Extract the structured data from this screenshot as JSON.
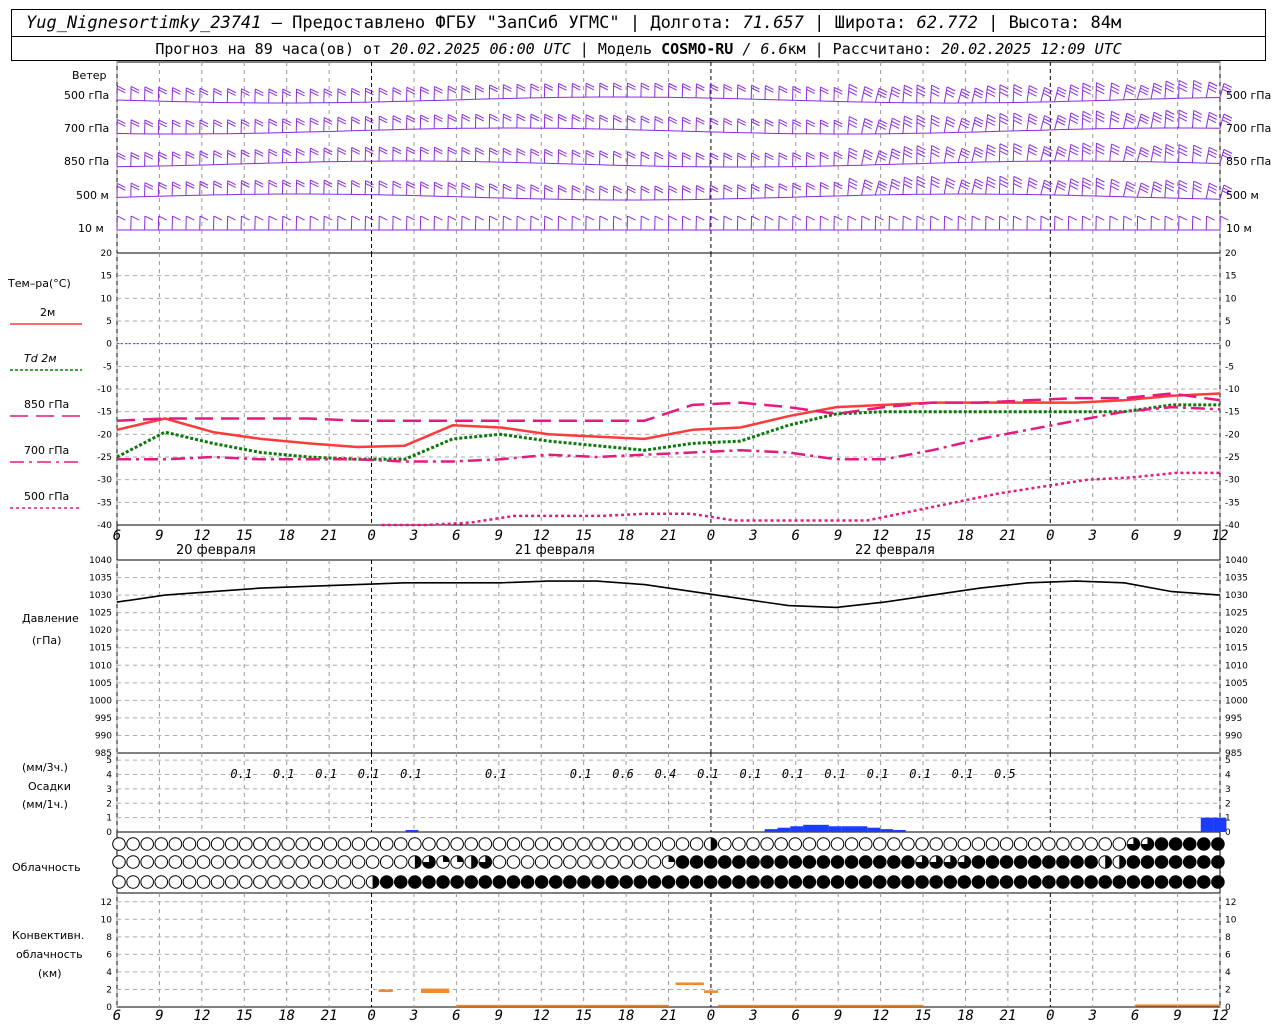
{
  "header": {
    "station": "Yug_Nignesortimky_23741",
    "provider": " – Предоставлено ФГБУ \"ЗапСиб УГМС\" | Долгота: ",
    "lon": "71.657",
    "lat_label": " | Широта: ",
    "lat": "62.772",
    "alt_label": " | Высота: ",
    "alt": "84м",
    "forecast_label": "Прогноз на 89 часа(ов) от ",
    "forecast_time": "20.02.2025 06:00 UTC",
    "model_label": "  | Модель ",
    "model": "COSMO-RU",
    "res": " / 6.6",
    "res_unit": "км",
    "calc_label": " | Рассчитано: ",
    "calc_time": "20.02.2025 12:09 UTC"
  },
  "colors": {
    "wind": "#8a2be2",
    "t2m": "#ff3b3b",
    "td2m": "#0a7a0a",
    "t850": "#e6197f",
    "t700": "#e6197f",
    "t500": "#e6197f",
    "pressure": "#000000",
    "precip": "#1a3cff",
    "convective": "#f08a30",
    "zero_line": "#3355ff"
  },
  "wind_panel": {
    "title": "Ветер",
    "levels": [
      "500 гПа",
      "700 гПа",
      "850 гПа",
      "500 м",
      "10  м"
    ]
  },
  "temp_panel": {
    "title": "Тем–ра(°С)",
    "legend": [
      {
        "label": "2м",
        "key": "t2m",
        "style": "solid"
      },
      {
        "label": "Td  2м",
        "key": "td2m",
        "style": "dotted"
      },
      {
        "label": "850 гПа",
        "key": "t850",
        "style": "longdash"
      },
      {
        "label": "700 гПа",
        "key": "t700",
        "style": "dashdot"
      },
      {
        "label": "500 гПа",
        "key": "t500",
        "style": "dotted"
      }
    ]
  },
  "pressure_panel": {
    "title": "Давление",
    "unit": "(гПа)"
  },
  "precip_panel": {
    "unit3": "(мм/3ч.)",
    "title": "Осадки",
    "unit1": "(мм/1ч.)"
  },
  "cloud_panel": {
    "title": "Облачность"
  },
  "conv_panel": {
    "title1": "Конвективн.",
    "title2": "облачность",
    "unit": "(км)"
  },
  "x_axis": {
    "hour_labels": [
      "6",
      "9",
      "12",
      "15",
      "18",
      "21",
      "0",
      "3",
      "6",
      "9",
      "12",
      "15",
      "18",
      "21",
      "0",
      "3",
      "6",
      "9",
      "12",
      "15",
      "18",
      "21",
      "0",
      "3",
      "6",
      "9",
      "12"
    ],
    "dates": [
      "20 февраля",
      "21 февраля",
      "22 февраля"
    ]
  },
  "chart_data": {
    "type": "line",
    "x_hours": [
      0,
      3,
      6,
      9,
      12,
      15,
      18,
      21,
      24,
      27,
      30,
      33,
      36,
      39,
      42,
      45,
      48,
      51,
      54,
      57,
      60,
      63,
      66,
      69,
      72,
      75,
      78
    ],
    "temperature": {
      "yticks": [
        20,
        15,
        10,
        5,
        0,
        -5,
        -10,
        -15,
        -20,
        -25,
        -30,
        -35,
        -40
      ],
      "ylim": [
        -40,
        20
      ],
      "series": [
        {
          "key": "t2m",
          "name": "2м",
          "values": [
            -19,
            -16.5,
            -19.5,
            -21,
            -22,
            -22.8,
            -22.5,
            -18,
            -18.5,
            -20,
            -20.5,
            -21,
            -19,
            -18.5,
            -16,
            -14,
            -13.5,
            -13,
            -13,
            -13,
            -13,
            -12.5,
            -11.5,
            -11
          ]
        },
        {
          "key": "td2m",
          "name": "Td 2м",
          "values": [
            -25,
            -19.5,
            -22,
            -24,
            -25,
            -25.5,
            -25.5,
            -21,
            -20,
            -21.5,
            -22.5,
            -23.5,
            -22,
            -21.5,
            -18,
            -15.5,
            -15,
            -15,
            -15,
            -15,
            -15,
            -15,
            -13.5,
            -13.5
          ]
        },
        {
          "key": "t850",
          "name": "850 гПа",
          "values": [
            -17,
            -16.5,
            -16.5,
            -16.5,
            -16.5,
            -17,
            -17,
            -17,
            -17,
            -17,
            -17,
            -17,
            -13.5,
            -13,
            -14,
            -15.5,
            -14,
            -13,
            -13,
            -12.5,
            -12,
            -12,
            -11,
            -12.5
          ]
        },
        {
          "key": "t700",
          "name": "700 гПа",
          "values": [
            -25.5,
            -25.5,
            -25,
            -25.5,
            -25.5,
            -25.5,
            -26,
            -26,
            -25.5,
            -24.5,
            -25,
            -24.5,
            -24,
            -23.5,
            -24,
            -25.5,
            -25.5,
            -23.5,
            -21,
            -19,
            -17,
            -15,
            -14,
            -14.5
          ]
        },
        {
          "key": "t500",
          "name": "500 гПа",
          "values": [
            null,
            null,
            null,
            null,
            null,
            null,
            -40,
            -40,
            -39.5,
            -38,
            -38,
            -38,
            -37.5,
            -37.5,
            -39,
            -39,
            -39,
            -39,
            -37,
            -35,
            -33,
            -31.5,
            -30,
            -29.5,
            -28.5,
            -28.5
          ]
        }
      ]
    },
    "pressure": {
      "yticks": [
        1040,
        1035,
        1030,
        1025,
        1020,
        1015,
        1010,
        1005,
        1000,
        995,
        990,
        985
      ],
      "ylim": [
        985,
        1040
      ],
      "values": [
        1028,
        1030,
        1031,
        1032,
        1032.5,
        1033,
        1033.5,
        1033.5,
        1033.5,
        1034,
        1034,
        1033,
        1031,
        1029,
        1027,
        1026.5,
        1028,
        1030,
        1032,
        1033.5,
        1034,
        1033.5,
        1031,
        1030
      ]
    },
    "precipitation": {
      "labels_3h": [
        "0.1",
        "0.1",
        "0.1",
        "0.1",
        "0.1",
        "0.1",
        "0.1",
        "0.6",
        "0.4",
        "0.1",
        "0.1",
        "0.1",
        "0.1",
        "0.1",
        "0.1",
        "0.1",
        "0.5"
      ],
      "label_hours": [
        9,
        12,
        15,
        18,
        21,
        27,
        33,
        36,
        39,
        42,
        45,
        48,
        51,
        54,
        57,
        60,
        63
      ],
      "yticks": [
        5,
        4,
        3,
        2,
        1,
        0
      ],
      "hourly": [
        0,
        0,
        0,
        0,
        0,
        0,
        0,
        0,
        0,
        0,
        0,
        0,
        0,
        0,
        0,
        0,
        0,
        0,
        0,
        0,
        0,
        0,
        0,
        0.05,
        0,
        0,
        0,
        0,
        0,
        0,
        0,
        0,
        0,
        0,
        0,
        0,
        0,
        0,
        0,
        0,
        0,
        0,
        0,
        0,
        0,
        0,
        0,
        0,
        0,
        0,
        0,
        0.1,
        0.15,
        0.2,
        0.25,
        0.25,
        0.2,
        0.2,
        0.2,
        0.15,
        0.1,
        0.05,
        0,
        0,
        0,
        0,
        0,
        0,
        0,
        0,
        0,
        0,
        0,
        0,
        0,
        0,
        0,
        0,
        0,
        0,
        0,
        0,
        0,
        0,
        0,
        0.5,
        0.5
      ]
    },
    "clouds": {
      "rows": [
        "ooooooooooooooooooooooooooooooooooooooooooooooooooooooooooooooooooooooooooooooooooooooooooooooooooooooooodooooooooooooooooooo",
        "ooooooooooooooooooooooooooooooooooooooooooooooooooooooooooooooooooooooooooooooooooooooooooooooooooooooooooooooooooo",
        "oooooooooooooooooooooooooooooooooooooooooooooooooooooooooooooooooooooooooooooooooooooooooooooooooooooooooooooooooo"
      ]
    },
    "convective": {
      "yticks": [
        12,
        10,
        8,
        6,
        4,
        2,
        0
      ],
      "ylim": [
        0,
        13
      ],
      "segments": [
        {
          "start": 18.5,
          "end": 19.5,
          "bottom": 1.7,
          "top": 2.0
        },
        {
          "start": 21.5,
          "end": 23.5,
          "bottom": 1.6,
          "top": 2.1
        },
        {
          "start": 24,
          "end": 39,
          "bottom": 0.1,
          "top": 0.25
        },
        {
          "start": 39.5,
          "end": 41.5,
          "bottom": 2.5,
          "top": 2.8
        },
        {
          "start": 41.5,
          "end": 42.5,
          "bottom": 1.6,
          "top": 1.9
        },
        {
          "start": 42.5,
          "end": 57,
          "bottom": 0.1,
          "top": 0.25
        },
        {
          "start": 72,
          "end": 78,
          "bottom": 0.1,
          "top": 0.3
        }
      ]
    }
  }
}
